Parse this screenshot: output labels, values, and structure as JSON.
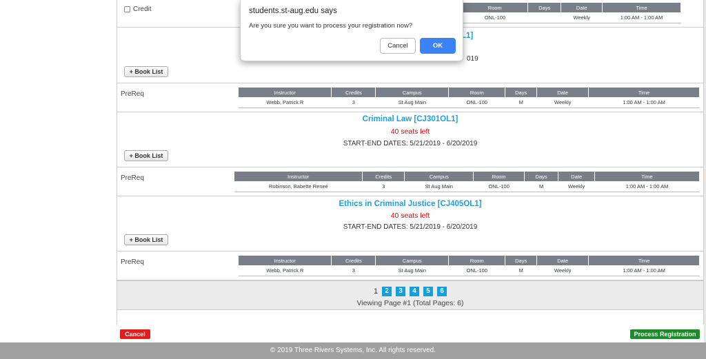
{
  "top": {
    "credit_label": "Credit",
    "partial_title_right": "OL1]",
    "partial_dates_right": "019",
    "book_list_label": "+ Book List",
    "table": {
      "headers": [
        "Room",
        "Days",
        "Date",
        "Time"
      ],
      "row": [
        "ONL-100",
        "",
        "Weekly",
        "1:00 AM - 1:00 AM"
      ]
    }
  },
  "courses": [
    {
      "prereq": "PreReq",
      "headers": [
        "Instructor",
        "Credits",
        "Campus",
        "Room",
        "Days",
        "Date",
        "Time"
      ],
      "row": [
        "Webb, Patrick R",
        "3",
        "St Aug Main",
        "ONL-100",
        "M",
        "Weekly",
        "1:00 AM - 1:00 AM"
      ],
      "next_title": "Criminal Law [CJ301OL1]",
      "next_seats": "40 seats left",
      "next_dates": "START-END DATES: 5/21/2019 - 6/20/2019",
      "book_list_label": "+ Book List"
    },
    {
      "prereq": "PreReq",
      "headers": [
        "Instructor",
        "Credits",
        "Campus",
        "Room",
        "Days",
        "Date",
        "Time"
      ],
      "row": [
        "Robinson, Babette Reneé",
        "3",
        "St Aug Main",
        "ONL-100",
        "M",
        "Weekly",
        "1:00 AM - 1:00 AM"
      ],
      "next_title": "Ethics in Criminal Justice [CJ405OL1]",
      "next_seats": "40 seats left",
      "next_dates": "START-END DATES: 5/21/2019 - 6/20/2019",
      "book_list_label": "+ Book List"
    },
    {
      "prereq": "PreReq",
      "headers": [
        "Instructor",
        "Credits",
        "Campus",
        "Room",
        "Days",
        "Date",
        "Time"
      ],
      "row": [
        "Webb, Patrick R",
        "3",
        "St Aug Main",
        "ONL-100",
        "M",
        "Weekly",
        "1:00 AM - 1:00 AM"
      ]
    }
  ],
  "pager": {
    "current": "1",
    "pages": [
      "2",
      "3",
      "4",
      "5",
      "6"
    ],
    "viewing": "Viewing Page #1 (Total Pages: 6)"
  },
  "actions": {
    "cancel": "Cancel",
    "process": "Process Registration"
  },
  "footer": "© 2019 Three Rivers Systems, Inc. All rights reserved.",
  "dialog": {
    "title": "students.st-aug.edu says",
    "message": "Are you sure you want to process your registration now?",
    "cancel": "Cancel",
    "ok": "OK"
  },
  "colors": {
    "accent_title": "#1ea1d8",
    "seats": "#ee0000",
    "cancel_button": "#e21d1d",
    "process_button": "#1e8b2a",
    "dialog_ok": "#3b82f6",
    "table_header": "#787f88"
  }
}
